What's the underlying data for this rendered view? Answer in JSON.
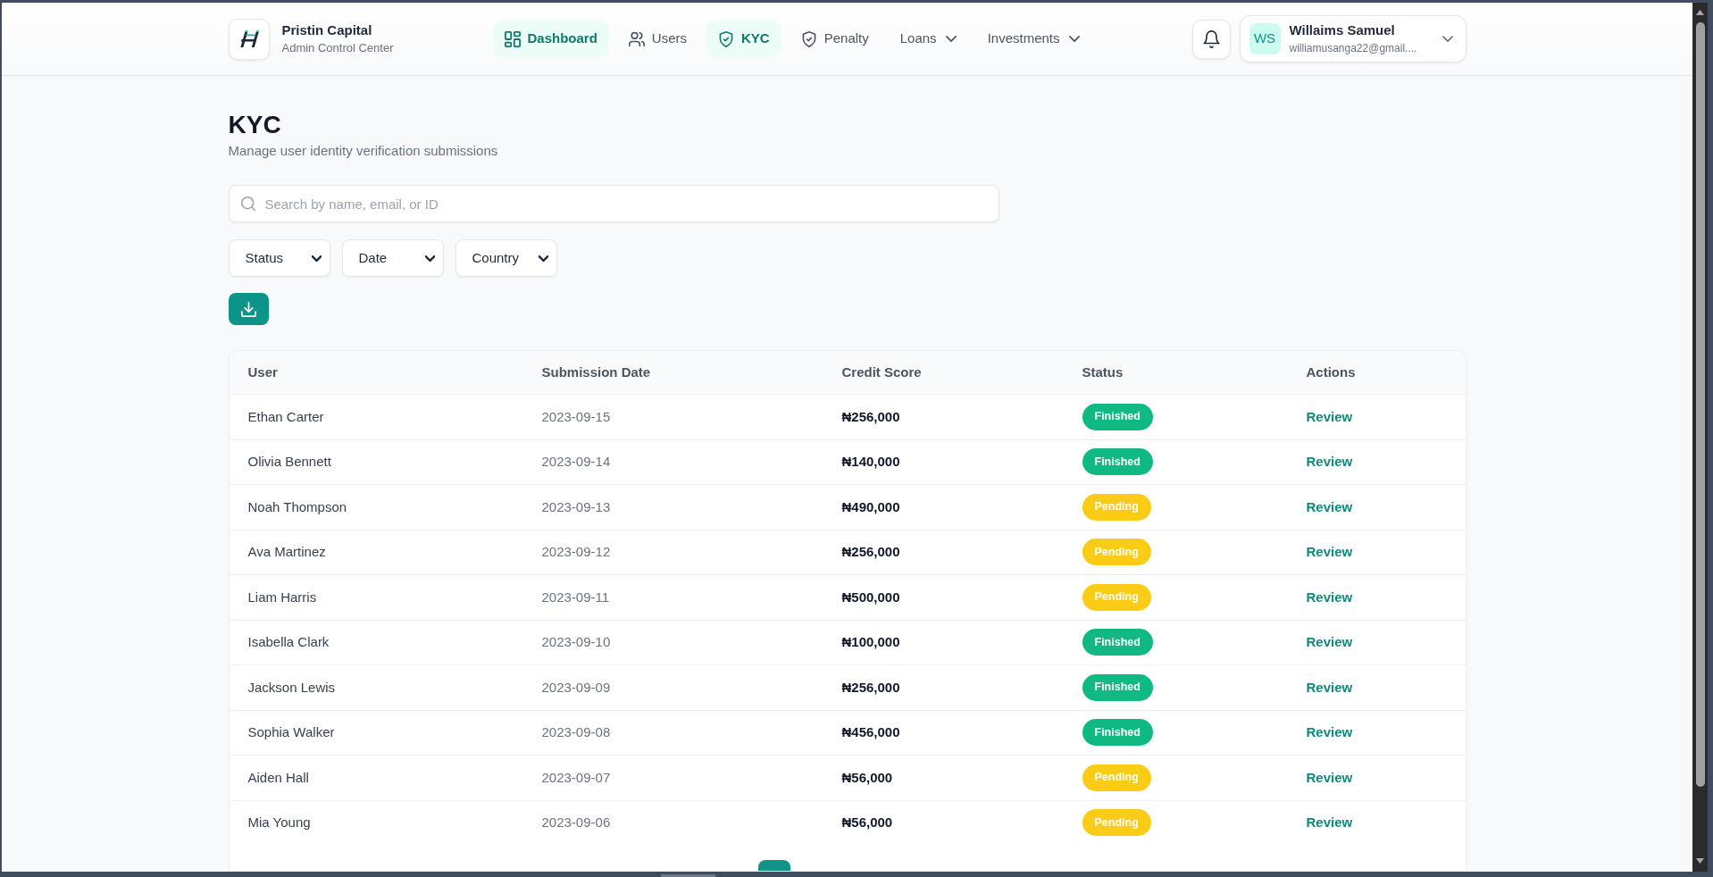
{
  "header": {
    "brand": {
      "name": "Pristin Capital",
      "subtitle": "Admin Control Center"
    },
    "nav": [
      {
        "label": "Dashboard",
        "kind": "link",
        "selected": true
      },
      {
        "label": "Users",
        "kind": "link",
        "selected": false
      },
      {
        "label": "KYC",
        "kind": "link",
        "selected": true
      },
      {
        "label": "Penalty",
        "kind": "link",
        "selected": false
      },
      {
        "label": "Loans",
        "kind": "dropdown",
        "selected": false
      },
      {
        "label": "Investments",
        "kind": "dropdown",
        "selected": false
      }
    ],
    "user": {
      "initials": "WS",
      "name": "Willaims Samuel",
      "email": "williamusanga22@gmail...."
    }
  },
  "page": {
    "title": "KYC",
    "subtitle": "Manage user identity verification submissions"
  },
  "search": {
    "placeholder": "Search by name, email, or ID"
  },
  "filters": [
    {
      "value": "Status"
    },
    {
      "value": "Date"
    },
    {
      "value": "Country"
    }
  ],
  "table": {
    "columns": [
      "User",
      "Submission Date",
      "Credit Score",
      "Status",
      "Actions"
    ],
    "rows": [
      {
        "user": "Ethan Carter",
        "submission_date": "2023-09-15",
        "credit_score": "₦256,000",
        "status": {
          "label": "Finished",
          "color": "#10b981"
        },
        "action": "Review"
      },
      {
        "user": "Olivia Bennett",
        "submission_date": "2023-09-14",
        "credit_score": "₦140,000",
        "status": {
          "label": "Finished",
          "color": "#10b981"
        },
        "action": "Review"
      },
      {
        "user": "Noah Thompson",
        "submission_date": "2023-09-13",
        "credit_score": "₦490,000",
        "status": {
          "label": "Pending",
          "color": "#facc15"
        },
        "action": "Review"
      },
      {
        "user": "Ava Martinez",
        "submission_date": "2023-09-12",
        "credit_score": "₦256,000",
        "status": {
          "label": "Pending",
          "color": "#facc15"
        },
        "action": "Review"
      },
      {
        "user": "Liam Harris",
        "submission_date": "2023-09-11",
        "credit_score": "₦500,000",
        "status": {
          "label": "Pending",
          "color": "#facc15"
        },
        "action": "Review"
      },
      {
        "user": "Isabella Clark",
        "submission_date": "2023-09-10",
        "credit_score": "₦100,000",
        "status": {
          "label": "Finished",
          "color": "#10b981"
        },
        "action": "Review"
      },
      {
        "user": "Jackson Lewis",
        "submission_date": "2023-09-09",
        "credit_score": "₦256,000",
        "status": {
          "label": "Finished",
          "color": "#10b981"
        },
        "action": "Review"
      },
      {
        "user": "Sophia Walker",
        "submission_date": "2023-09-08",
        "credit_score": "₦456,000",
        "status": {
          "label": "Finished",
          "color": "#10b981"
        },
        "action": "Review"
      },
      {
        "user": "Aiden Hall",
        "submission_date": "2023-09-07",
        "credit_score": "₦56,000",
        "status": {
          "label": "Pending",
          "color": "#facc15"
        },
        "action": "Review"
      },
      {
        "user": "Mia Young",
        "submission_date": "2023-09-06",
        "credit_score": "₦56,000",
        "status": {
          "label": "Pending",
          "color": "#facc15"
        },
        "action": "Review"
      }
    ]
  },
  "pagination": {
    "pages": [
      {
        "selected": true
      }
    ]
  }
}
